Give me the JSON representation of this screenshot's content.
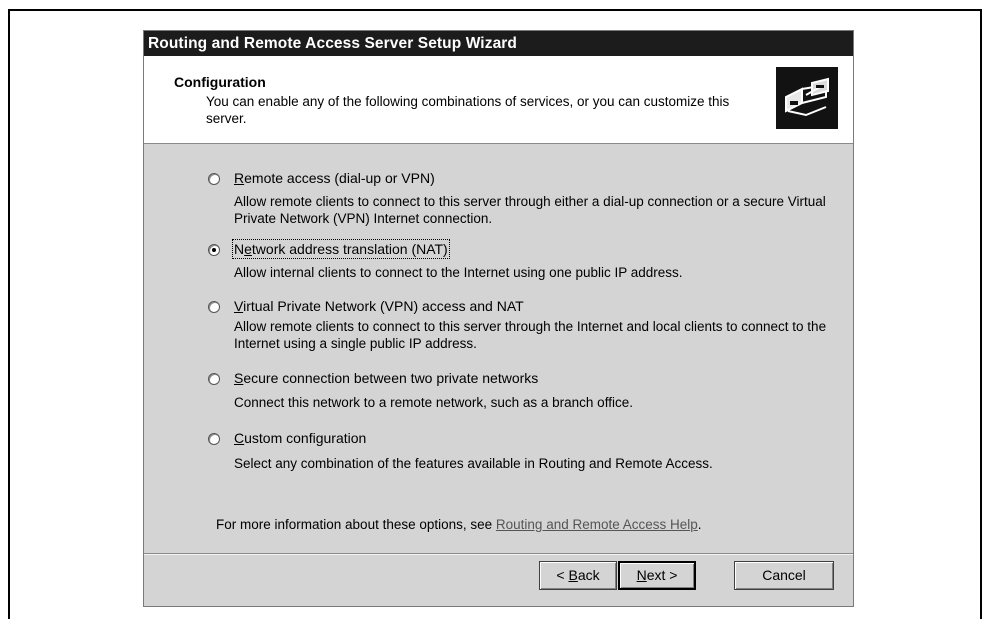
{
  "window": {
    "title": "Routing and Remote Access Server Setup Wizard"
  },
  "header": {
    "title": "Configuration",
    "description": "You can enable any of the following combinations of services, or you can customize this server.",
    "icon": "network-wizard-icon"
  },
  "options": [
    {
      "label_prefix": "",
      "label_mnemonic": "R",
      "label_rest": "emote access (dial-up or VPN)",
      "description": "Allow remote clients to connect to this server through either a dial-up connection or a secure Virtual Private Network (VPN) Internet connection.",
      "selected": false
    },
    {
      "label_prefix": "N",
      "label_mnemonic": "e",
      "label_rest": "twork address translation (NAT)",
      "description": "Allow internal clients to connect to the Internet using one public IP address.",
      "selected": true
    },
    {
      "label_prefix": "",
      "label_mnemonic": "V",
      "label_rest": "irtual Private Network (VPN) access and NAT",
      "description": "Allow remote clients to connect to this server through the Internet and local clients to connect to the Internet using a single public IP address.",
      "selected": false
    },
    {
      "label_prefix": "",
      "label_mnemonic": "S",
      "label_rest": "ecure connection between two private networks",
      "description": "Connect this network to a remote network, such as a branch office.",
      "selected": false
    },
    {
      "label_prefix": "",
      "label_mnemonic": "C",
      "label_rest": "ustom configuration",
      "description": "Select any combination of the features available in Routing and Remote Access.",
      "selected": false
    }
  ],
  "info": {
    "text": "For more information about these options, see ",
    "link": "Routing and Remote Access Help",
    "suffix": "."
  },
  "buttons": {
    "back_prefix": "< ",
    "back_mnemonic": "B",
    "back_rest": "ack",
    "next_mnemonic": "N",
    "next_rest": "ext >",
    "cancel": "Cancel"
  }
}
